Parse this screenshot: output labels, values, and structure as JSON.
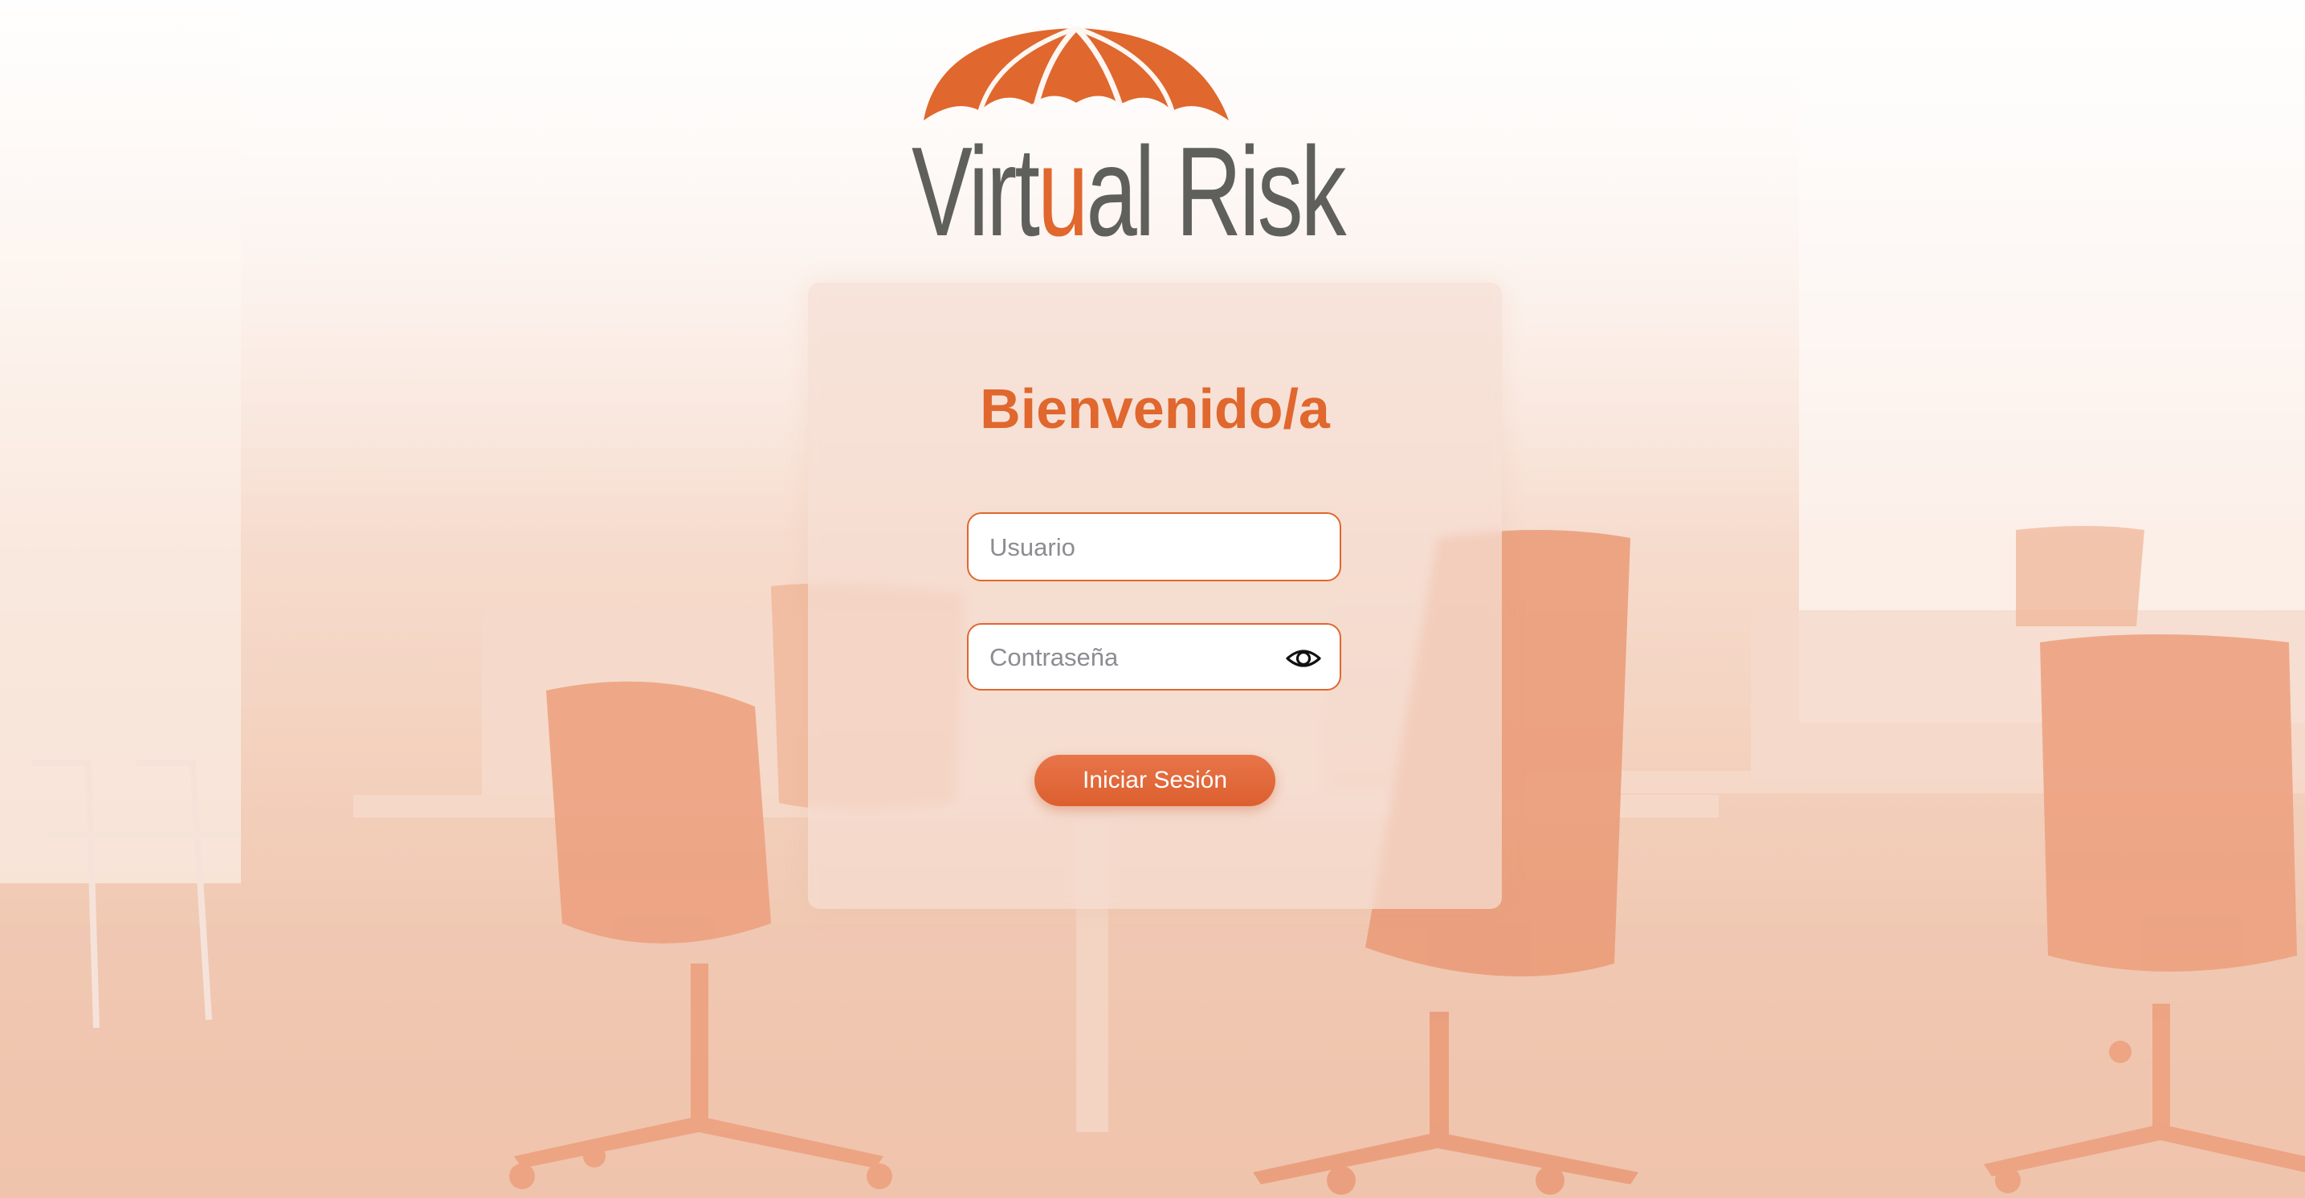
{
  "brand": {
    "name_prefix": "Virt",
    "name_u": "u",
    "name_suffix": "al Risk",
    "logo_icon": "umbrella-icon",
    "accent_color": "#e0672d",
    "text_color": "#5f5f5c"
  },
  "login": {
    "title": "Bienvenido/a",
    "username_placeholder": "Usuario",
    "password_placeholder": "Contraseña",
    "toggle_password_icon": "eye-icon",
    "submit_label": "Iniciar Sesión"
  },
  "background": {
    "scene": "office-chairs-background"
  }
}
